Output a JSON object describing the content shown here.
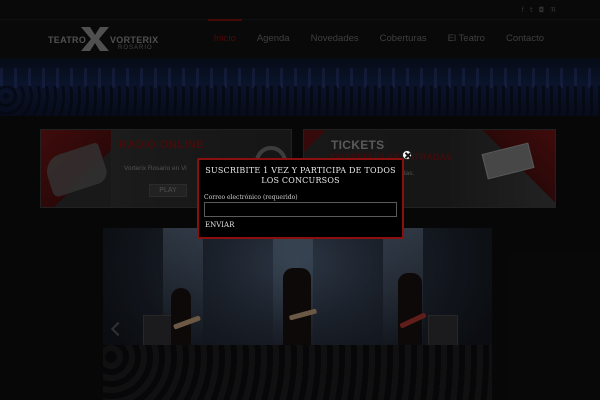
{
  "social": {
    "icons": [
      "facebook-icon",
      "twitter-icon",
      "instagram-icon",
      "rss-icon"
    ],
    "glyphs": [
      "f",
      "t",
      "◘",
      "ℜ"
    ]
  },
  "logo": {
    "word1": "TEATRO",
    "word2": "VORTERIX",
    "city": "ROSARIO"
  },
  "nav": {
    "items": [
      {
        "label": "Inicio",
        "active": true
      },
      {
        "label": "Agenda",
        "active": false
      },
      {
        "label": "Novedades",
        "active": false
      },
      {
        "label": "Coberturas",
        "active": false
      },
      {
        "label": "El Teatro",
        "active": false
      },
      {
        "label": "Contacto",
        "active": false
      }
    ]
  },
  "banners": {
    "radio": {
      "title": "RADIO ONLINE",
      "subtitle": "Vorterix Rosario en Vi",
      "button": "PLAY"
    },
    "tickets": {
      "title": "TICKETS",
      "subtitle": "CONSEGUÍ LAS ENTRADAS",
      "text": "das."
    }
  },
  "modal": {
    "heading": "SUSCRIBITE 1 VEZ Y PARTICIPA DE TODOS LOS CONCURSOS",
    "email_label": "Correo electrónico (requerido)",
    "email_value": "",
    "email_placeholder": "",
    "submit_label": "ENVIAR"
  },
  "colors": {
    "accent": "#7d1111",
    "modal_border": "#8a1010",
    "background": "#0c0c0c"
  }
}
